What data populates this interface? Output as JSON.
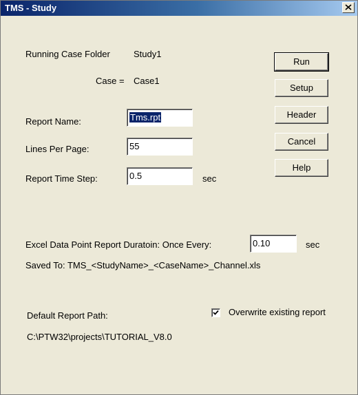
{
  "window": {
    "title": "TMS - Study"
  },
  "case_info": {
    "folder_label": "Running Case Folder",
    "folder_value": "Study1",
    "case_label": "Case =",
    "case_value": "Case1"
  },
  "fields": {
    "report_name": {
      "label": "Report Name:",
      "value": "Tms.rpt"
    },
    "lines_per_page": {
      "label": "Lines Per Page:",
      "value": "55"
    },
    "report_time_step": {
      "label": "Report Time Step:",
      "value": "0.5",
      "unit": "sec"
    }
  },
  "buttons": {
    "run": "Run",
    "setup": "Setup",
    "header": "Header",
    "cancel": "Cancel",
    "help": "Help"
  },
  "excel": {
    "label": "Excel Data Point Report Duratoin: Once Every:",
    "value": "0.10",
    "unit": "sec",
    "saved_to": "Saved To: TMS_<StudyName>_<CaseName>_Channel.xls"
  },
  "report_path": {
    "label": "Default Report Path:",
    "value": "C:\\PTW32\\projects\\TUTORIAL_V8.0"
  },
  "overwrite": {
    "label": "Overwrite existing report",
    "checked": true
  }
}
